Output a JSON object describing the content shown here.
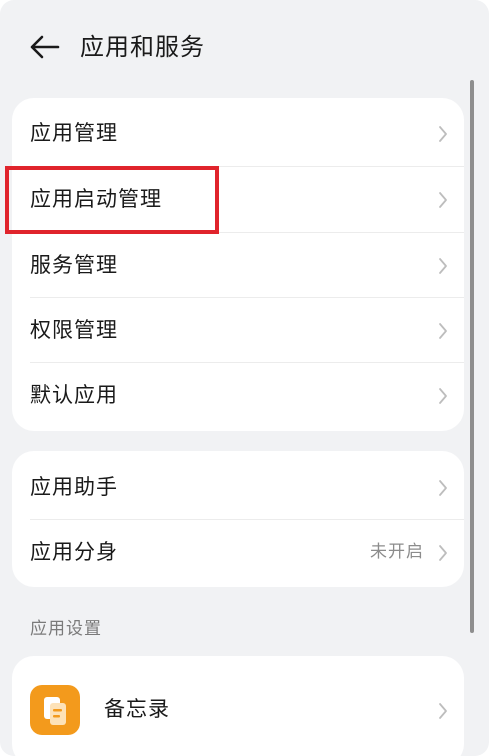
{
  "header": {
    "title": "应用和服务",
    "back_icon": "back-arrow-icon"
  },
  "main_list": [
    {
      "label": "应用管理"
    },
    {
      "label": "应用启动管理"
    },
    {
      "label": "服务管理"
    },
    {
      "label": "权限管理"
    },
    {
      "label": "默认应用"
    }
  ],
  "helpers_list": [
    {
      "label": "应用助手",
      "value": ""
    },
    {
      "label": "应用分身",
      "value": "未开启"
    }
  ],
  "app_settings": {
    "section_title": "应用设置",
    "apps": [
      {
        "label": "备忘录",
        "icon": "notes-app-icon",
        "icon_color": "#f39a1c"
      }
    ]
  },
  "colors": {
    "background": "#f1f2f4",
    "card": "#ffffff",
    "highlight": "#e0242c",
    "secondary_text": "#8c8c8c"
  },
  "annotation": {
    "highlighted_item": "应用启动管理"
  }
}
